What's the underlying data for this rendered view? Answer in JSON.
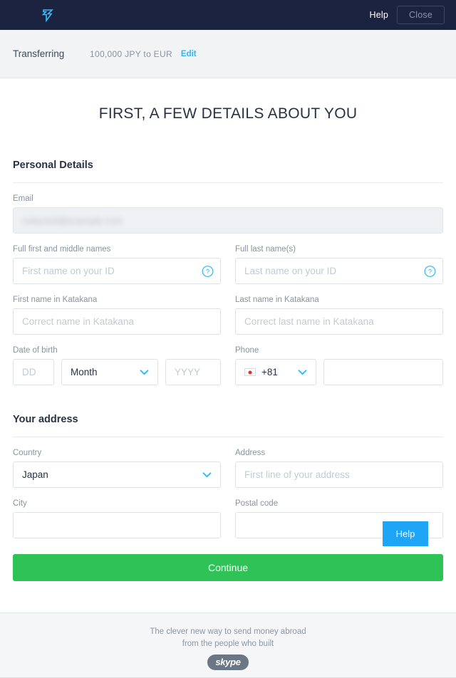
{
  "header": {
    "logo_name": "transferwise-logo",
    "help_label": "Help",
    "close_label": "Close"
  },
  "summary": {
    "label": "Transferring",
    "amount": "100,000 JPY to EUR",
    "edit_label": "Edit"
  },
  "page": {
    "title": "FIRST, A FEW DETAILS ABOUT YOU"
  },
  "personal": {
    "section_title": "Personal Details",
    "email_label": "Email",
    "email_value": "redacted@example.com",
    "first_name_label": "Full first and middle names",
    "first_name_placeholder": "First name on your ID",
    "last_name_label": "Full last name(s)",
    "last_name_placeholder": "Last name on your ID",
    "first_katakana_label": "First name in Katakana",
    "first_katakana_placeholder": "Correct name in Katakana",
    "last_katakana_label": "Last name in Katakana",
    "last_katakana_placeholder": "Correct last name in Katakana",
    "dob_label": "Date of birth",
    "dob_day_placeholder": "DD",
    "dob_month_value": "Month",
    "dob_year_placeholder": "YYYY",
    "phone_label": "Phone",
    "phone_code_value": "+81",
    "phone_number_value": ""
  },
  "address": {
    "section_title": "Your address",
    "country_label": "Country",
    "country_value": "Japan",
    "address_label": "Address",
    "address_placeholder": "First line of your address",
    "city_label": "City",
    "city_value": "",
    "postal_label": "Postal code",
    "postal_value": ""
  },
  "actions": {
    "continue_label": "Continue",
    "help_widget_label": "Help"
  },
  "footer": {
    "line1": "The clever new way to send money abroad",
    "line2": "from the people who built",
    "brand": "skype"
  },
  "colors": {
    "header_bg": "#1c2340",
    "accent_blue": "#2db8f5",
    "continue_green": "#2fc357",
    "help_blue": "#1fa5f5"
  }
}
